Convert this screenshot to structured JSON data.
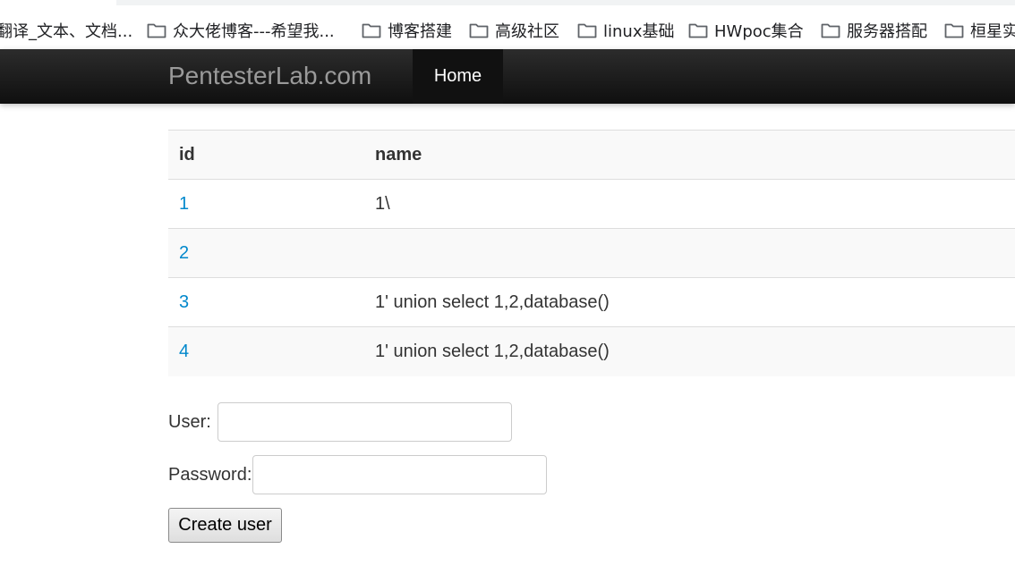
{
  "bookmarks": [
    {
      "label": "翻译_文本、文档..."
    },
    {
      "label": "众大佬博客---希望我..."
    },
    {
      "label": "博客搭建"
    },
    {
      "label": "高级社区"
    },
    {
      "label": "linux基础"
    },
    {
      "label": "HWpoc集合"
    },
    {
      "label": "服务器搭配"
    },
    {
      "label": "桓星实"
    }
  ],
  "navbar": {
    "brand": "PentesterLab.com",
    "home": "Home"
  },
  "table": {
    "headers": {
      "id": "id",
      "name": "name"
    },
    "rows": [
      {
        "id": "1",
        "name": "1\\"
      },
      {
        "id": "2",
        "name": ""
      },
      {
        "id": "3",
        "name": "1' union select 1,2,database()"
      },
      {
        "id": "4",
        "name": "1' union select 1,2,database()"
      }
    ]
  },
  "form": {
    "user_label": "User:",
    "user_value": "",
    "password_label": "Password:",
    "password_value": "",
    "submit_label": "Create user"
  },
  "colors": {
    "navbar": "#1a1a1a",
    "link": "#0088cc",
    "brand": "#9a9a9a"
  }
}
